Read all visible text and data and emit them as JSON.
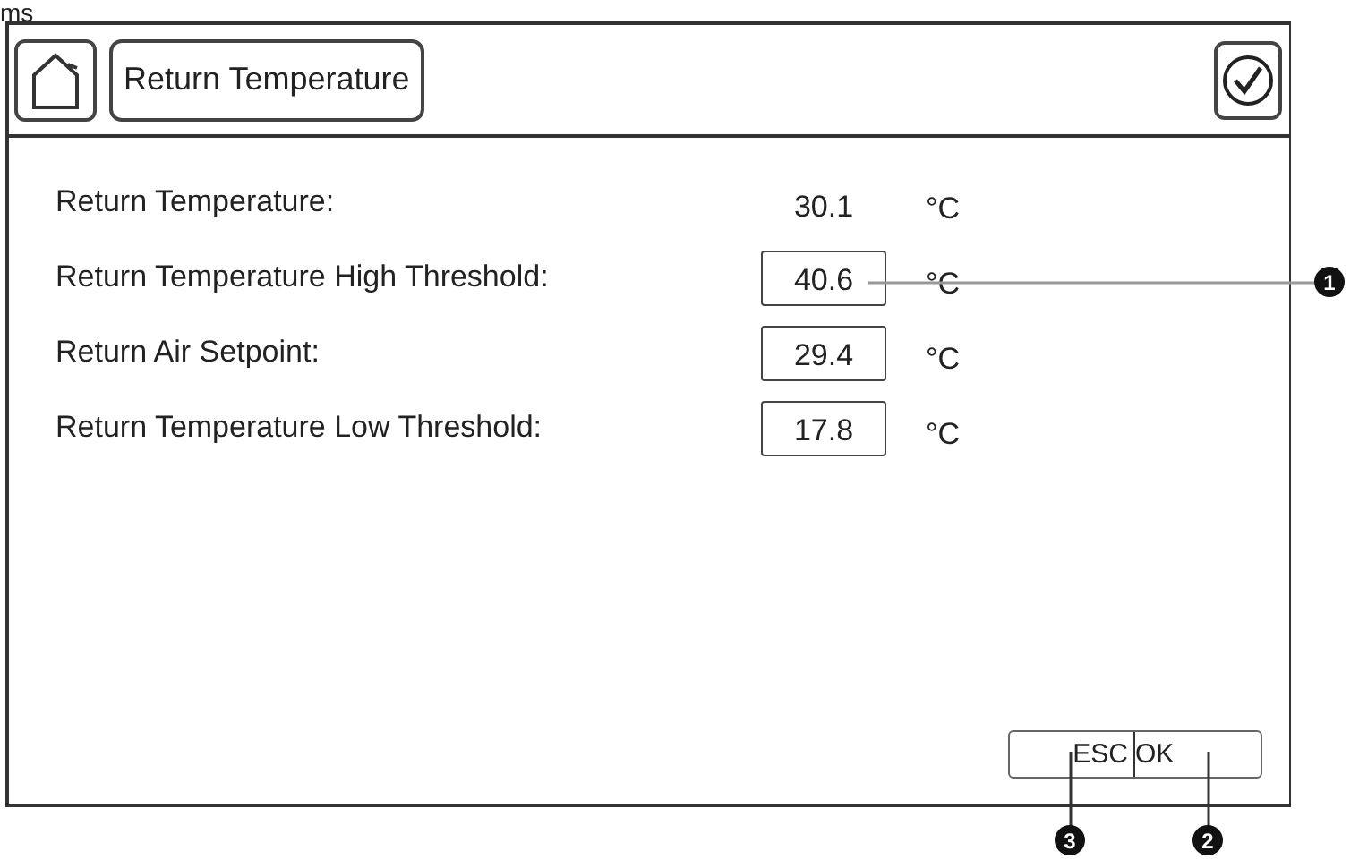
{
  "caption_fragment": "ms",
  "header": {
    "title": "Return Temperature"
  },
  "rows": [
    {
      "kind": "reading",
      "label": "Return Temperature:",
      "value": "30.1",
      "unit": "°C"
    },
    {
      "kind": "input",
      "label": "Return Temperature High Threshold:",
      "value": "40.6",
      "unit": "°C"
    },
    {
      "kind": "input",
      "label": "Return Air Setpoint:",
      "value": "29.4",
      "unit": "°C"
    },
    {
      "kind": "input",
      "label": "Return Temperature Low Threshold:",
      "value": "17.8",
      "unit": "°C"
    }
  ],
  "softkeys": [
    "ESC",
    "OK"
  ],
  "callouts": [
    "1",
    "2",
    "3"
  ]
}
